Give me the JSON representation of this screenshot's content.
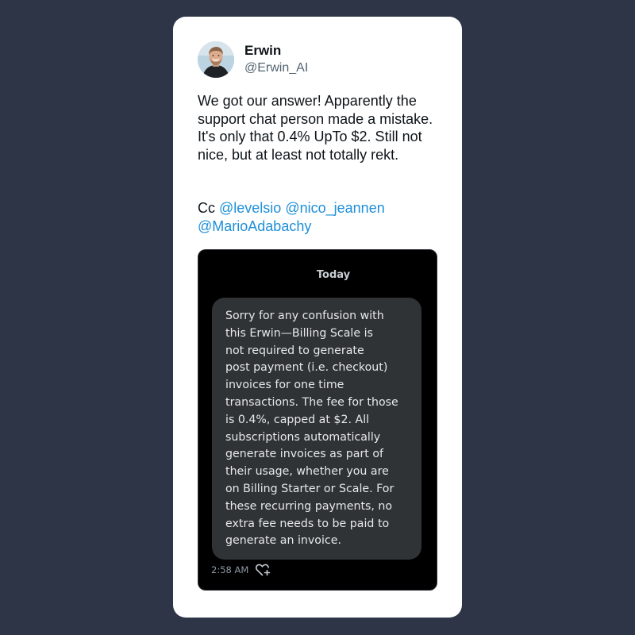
{
  "author": {
    "name": "Erwin",
    "handle": "@Erwin_AI",
    "avatar_icon": "profile-photo"
  },
  "tweet": {
    "text": "We got our answer! Apparently the support chat person made a mistake. It's only that 0.4% UpTo $2. Still not nice, but at least not totally rekt.",
    "cc_prefix": "Cc",
    "mentions": [
      "@levelsio",
      "@nico_jeannen",
      "@MarioAdabachy"
    ]
  },
  "screenshot": {
    "date_label": "Today",
    "message": "Sorry for any confusion with\nthis Erwin—Billing Scale is\nnot required to generate\npost payment (i.e. checkout)\ninvoices for one time\ntransactions. The fee for those\nis 0.4%, capped at $2. All\nsubscriptions automatically\ngenerate invoices as part of\ntheir usage, whether you are\non Billing Starter or Scale. For\nthese recurring payments, no\nextra fee needs to be paid to\ngenerate an invoice.",
    "time": "2:58 AM",
    "reaction_icon": "heart-plus-icon"
  },
  "colors": {
    "background": "#2d3546",
    "card": "#ffffff",
    "mention": "#1d8fd8",
    "bubble": "#2f3336"
  }
}
